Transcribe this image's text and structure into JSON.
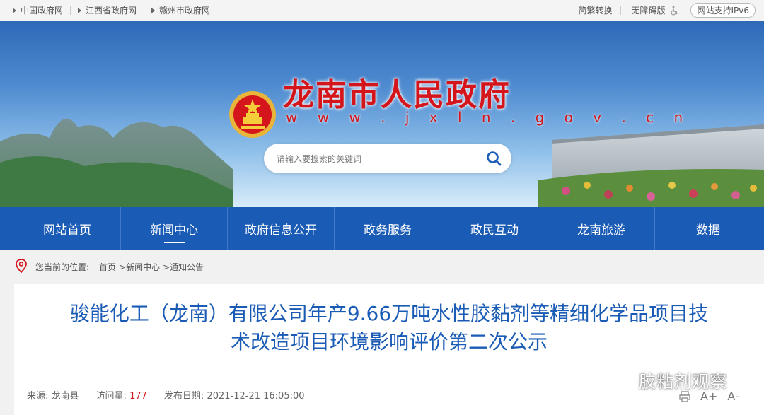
{
  "topbar": {
    "links": [
      "中国政府网",
      "江西省政府网",
      "赣州市政府网"
    ],
    "traditional": "简繁转换",
    "accessibility": "无障碍版",
    "ipv6": "网站支持IPv6"
  },
  "header": {
    "title": "龙南市人民政府",
    "url": "w w w . j x l n . g o v . c n"
  },
  "search": {
    "placeholder": "请输入要搜索的关键词"
  },
  "nav": {
    "items": [
      "网站首页",
      "新闻中心",
      "政府信息公开",
      "政务服务",
      "政民互动",
      "龙南旅游",
      "数据"
    ],
    "active": 1
  },
  "breadcrumb": {
    "label": "您当前的位置:",
    "items": [
      "首页",
      ">新闻中心",
      ">通知公告"
    ]
  },
  "article": {
    "title_line1": "骏能化工（龙南）有限公司年产9.66万吨水性胶黏剂等精细化学品项目技",
    "title_line2": "术改造项目环境影响评价第二次公示",
    "source_label": "来源:",
    "source": "龙南县",
    "visits_label": "访问量:",
    "visits": "177",
    "date_label": "发布日期:",
    "date": "2021-12-21 16:05:00"
  },
  "watermark": {
    "text": "胶粘剂观察"
  },
  "tools": {
    "font_increase": "A+",
    "font_decrease": "A-"
  },
  "colors": {
    "brand_blue": "#1a5bb5",
    "title_red": "#d4151b",
    "accent_red": "#d4151b"
  }
}
